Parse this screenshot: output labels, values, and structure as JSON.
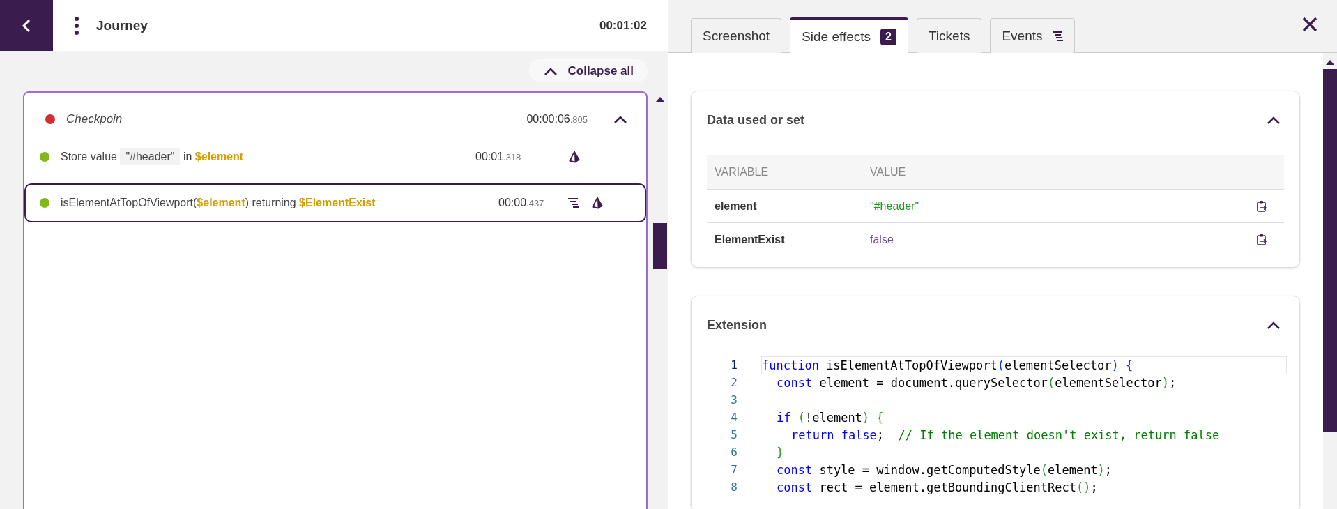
{
  "header": {
    "title": "Journey",
    "duration": "00:01:02"
  },
  "toolbar": {
    "collapse_label": "Collapse all"
  },
  "checkpoint": {
    "title": "Checkpoin",
    "time_main": "00:00:06",
    "time_ms": ".805",
    "expanded": true,
    "color": "#d32f2f",
    "steps": [
      {
        "color": "#84b819",
        "selected": false,
        "parts": [
          {
            "kind": "plain",
            "text": "Store value"
          },
          {
            "kind": "literal",
            "text": "\"#header\""
          },
          {
            "kind": "plain",
            "text": "in"
          },
          {
            "kind": "variable",
            "text": "$element"
          }
        ],
        "time_main": "00:01",
        "time_ms": ".318",
        "has_events": false
      },
      {
        "color": "#84b819",
        "selected": true,
        "parts": [
          {
            "kind": "plain",
            "text": "isElementAtTopOfViewport("
          },
          {
            "kind": "variable",
            "text": "$element"
          },
          {
            "kind": "plain",
            "text": ") returning"
          },
          {
            "kind": "variable",
            "text": "$ElementExist"
          }
        ],
        "time_main": "00:00",
        "time_ms": ".437",
        "has_events": true
      }
    ]
  },
  "tabs": [
    {
      "label": "Screenshot",
      "selected": false,
      "kind": "plain"
    },
    {
      "label": "Side effects",
      "selected": true,
      "kind": "badge",
      "badge": "2"
    },
    {
      "label": "Tickets",
      "selected": false,
      "kind": "plain"
    },
    {
      "label": "Events",
      "selected": false,
      "kind": "events"
    }
  ],
  "data_section": {
    "title": "Data used or set",
    "expanded": true,
    "columns": [
      "VARIABLE",
      "VALUE"
    ],
    "rows": [
      {
        "variable": "element",
        "value": "\"#header\"",
        "kind": "string"
      },
      {
        "variable": "ElementExist",
        "value": "false",
        "kind": "boolean"
      }
    ]
  },
  "extension_section": {
    "title": "Extension",
    "expanded": true,
    "code": [
      {
        "number": "1",
        "current": true,
        "tokens": [
          {
            "kind": "keyword",
            "text": "function"
          },
          {
            "kind": "plain",
            "text": " isElementAtTopOfViewport"
          },
          {
            "kind": "bracket",
            "text": "("
          },
          {
            "kind": "plain",
            "text": "elementSelector"
          },
          {
            "kind": "bracket",
            "text": ")"
          },
          {
            "kind": "bracket",
            "text": " {"
          }
        ],
        "children": [
          {
            "number": "2",
            "current": false,
            "tokens": [
              {
                "kind": "keyword",
                "text": "const"
              },
              {
                "kind": "plain",
                "text": " element = document.querySelector"
              },
              {
                "kind": "bracket2",
                "text": "("
              },
              {
                "kind": "plain",
                "text": "elementSelector"
              },
              {
                "kind": "bracket2",
                "text": ")"
              },
              {
                "kind": "plain",
                "text": ";"
              }
            ]
          },
          {
            "number": "3",
            "current": false
          },
          {
            "number": "4",
            "current": false,
            "tokens": [
              {
                "kind": "keyword",
                "text": "if"
              },
              {
                "kind": "bracket2",
                "text": " ("
              },
              {
                "kind": "plain",
                "text": "!element"
              },
              {
                "kind": "bracket2",
                "text": ")"
              },
              {
                "kind": "bracket2",
                "text": " {"
              }
            ],
            "children": [
              {
                "number": "5",
                "current": false,
                "tokens": [
                  {
                    "kind": "keyword",
                    "text": "return"
                  },
                  {
                    "kind": "keyword",
                    "text": " false"
                  },
                  {
                    "kind": "plain",
                    "text": ";"
                  },
                  {
                    "kind": "comment",
                    "text": "  // If the element doesn't exist, return false"
                  }
                ]
              }
            ]
          },
          {
            "number": "6",
            "current": false,
            "tokens": [
              {
                "kind": "bracket2",
                "text": "}"
              }
            ]
          },
          {
            "number": "7",
            "current": false,
            "tokens": [
              {
                "kind": "keyword",
                "text": "const"
              },
              {
                "kind": "plain",
                "text": " style = window.getComputedStyle"
              },
              {
                "kind": "bracket2",
                "text": "("
              },
              {
                "kind": "plain",
                "text": "element"
              },
              {
                "kind": "bracket2",
                "text": ")"
              },
              {
                "kind": "plain",
                "text": ";"
              }
            ]
          },
          {
            "number": "8",
            "current": false,
            "tokens": [
              {
                "kind": "keyword",
                "text": "const"
              },
              {
                "kind": "plain",
                "text": " rect = element.getBoundingClientRect"
              },
              {
                "kind": "bracket2",
                "text": "()"
              },
              {
                "kind": "plain",
                "text": ";"
              }
            ]
          }
        ]
      }
    ]
  }
}
